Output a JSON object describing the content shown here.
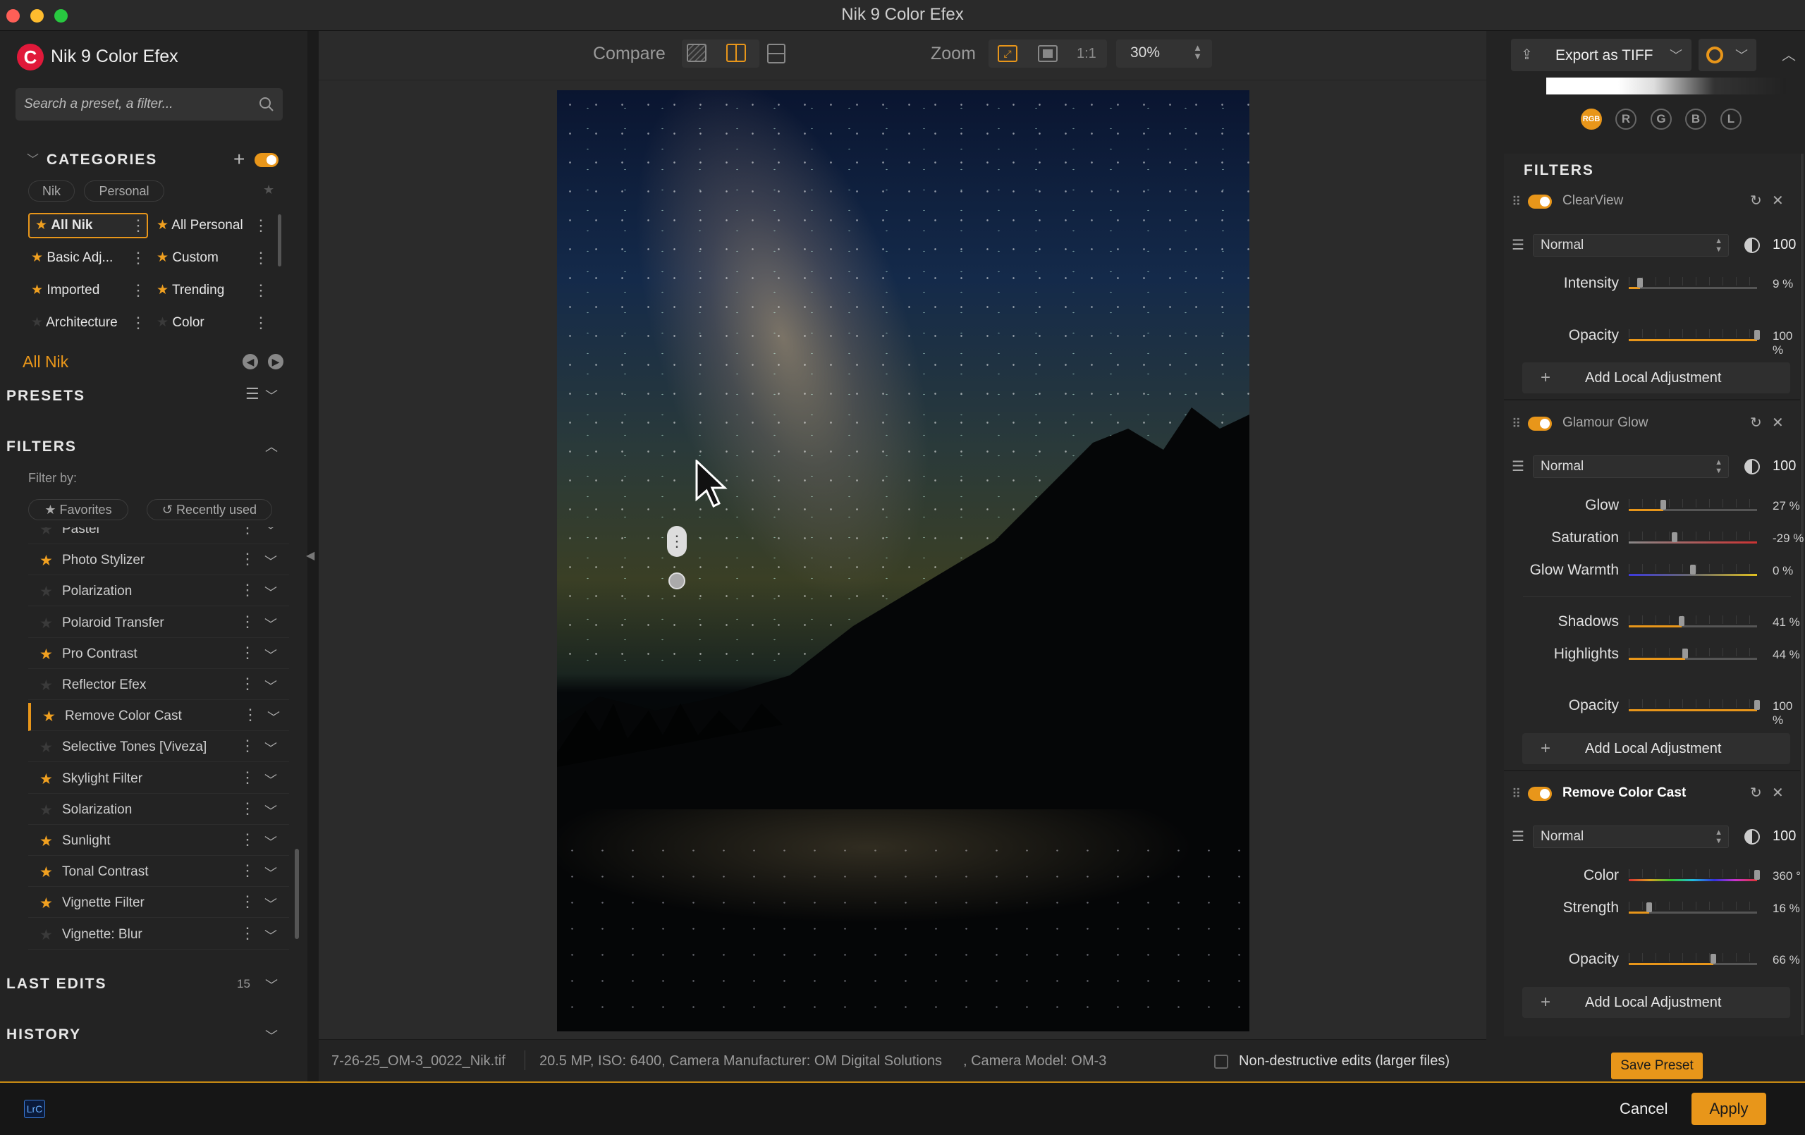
{
  "window": {
    "title": "Nik 9 Color Efex"
  },
  "app": {
    "name": "Nik 9 Color Efex",
    "search_placeholder": "Search a preset, a filter..."
  },
  "categories": {
    "header": "CATEGORIES",
    "tabs": [
      "Nik",
      "Personal"
    ],
    "items": [
      {
        "label": "All Nik",
        "fav": true,
        "active": true
      },
      {
        "label": "All Personal",
        "fav": true
      },
      {
        "label": "Basic Adj...",
        "fav": true
      },
      {
        "label": "Custom",
        "fav": true
      },
      {
        "label": "Imported",
        "fav": true
      },
      {
        "label": "Trending",
        "fav": true
      },
      {
        "label": "Architecture",
        "fav": false
      },
      {
        "label": "Color",
        "fav": false
      }
    ],
    "selected": "All Nik"
  },
  "presets": {
    "header": "PRESETS"
  },
  "filters_panel": {
    "header": "FILTERS",
    "filter_by": "Filter by:",
    "favorites_label": "Favorites",
    "recent_label": "Recently used",
    "items": [
      {
        "name": "Pastel",
        "fav": false
      },
      {
        "name": "Photo Stylizer",
        "fav": true
      },
      {
        "name": "Polarization",
        "fav": false
      },
      {
        "name": "Polaroid Transfer",
        "fav": false
      },
      {
        "name": "Pro Contrast",
        "fav": true
      },
      {
        "name": "Reflector Efex",
        "fav": false
      },
      {
        "name": "Remove Color Cast",
        "fav": true,
        "active": true
      },
      {
        "name": "Selective Tones [Viveza]",
        "fav": false
      },
      {
        "name": "Skylight Filter",
        "fav": true
      },
      {
        "name": "Solarization",
        "fav": false
      },
      {
        "name": "Sunlight",
        "fav": true
      },
      {
        "name": "Tonal Contrast",
        "fav": true
      },
      {
        "name": "Vignette Filter",
        "fav": true
      },
      {
        "name": "Vignette: Blur",
        "fav": false
      }
    ]
  },
  "last_edits": {
    "header": "LAST EDITS",
    "count": "15"
  },
  "history": {
    "header": "HISTORY"
  },
  "toolbar": {
    "compare_label": "Compare",
    "zoom_label": "Zoom",
    "zoom_one": "1:1",
    "zoom_value": "30%",
    "export_label": "Export as TIFF"
  },
  "status": {
    "filename": "7-26-25_OM-3_0022_Nik.tif",
    "info": "20.5 MP, ISO: 6400, Camera Manufacturer: OM Digital Solutions",
    "model": ", Camera Model: OM-3",
    "nondestructive": "Non-destructive edits (larger files)"
  },
  "histogram": {
    "channels": [
      "RGB",
      "R",
      "G",
      "B",
      "L"
    ]
  },
  "right": {
    "filters_header": "FILTERS",
    "add_local": "Add Local Adjustment",
    "save_preset": "Save Preset",
    "filters": [
      {
        "name": "ClearView",
        "blend": "Normal",
        "amount": "100",
        "bold": false,
        "params": [
          {
            "label": "Intensity",
            "value": "9 %",
            "pct": 0.09
          },
          {
            "label": "Opacity",
            "value": "100 %",
            "pct": 1.0
          }
        ]
      },
      {
        "name": "Glamour Glow",
        "blend": "Normal",
        "amount": "100",
        "bold": false,
        "params": [
          {
            "label": "Glow",
            "value": "27 %",
            "pct": 0.27
          },
          {
            "label": "Saturation",
            "value": "-29 %",
            "pct": 0.355,
            "gradient": "sat"
          },
          {
            "label": "Glow Warmth",
            "value": "0 %",
            "pct": 0.5,
            "gradient": "warm"
          },
          {
            "label": "Shadows",
            "value": "41 %",
            "pct": 0.41
          },
          {
            "label": "Highlights",
            "value": "44 %",
            "pct": 0.44
          },
          {
            "label": "Opacity",
            "value": "100 %",
            "pct": 1.0
          }
        ]
      },
      {
        "name": "Remove Color Cast",
        "blend": "Normal",
        "amount": "100",
        "bold": true,
        "params": [
          {
            "label": "Color",
            "value": "360 °",
            "pct": 1.0,
            "gradient": "hue"
          },
          {
            "label": "Strength",
            "value": "16 %",
            "pct": 0.16
          },
          {
            "label": "Opacity",
            "value": "66 %",
            "pct": 0.66
          }
        ]
      }
    ]
  },
  "footer": {
    "cancel": "Cancel",
    "apply": "Apply",
    "lrc_badge": "LrC"
  },
  "colors": {
    "accent": "#e8961a",
    "bg": "#232323"
  }
}
